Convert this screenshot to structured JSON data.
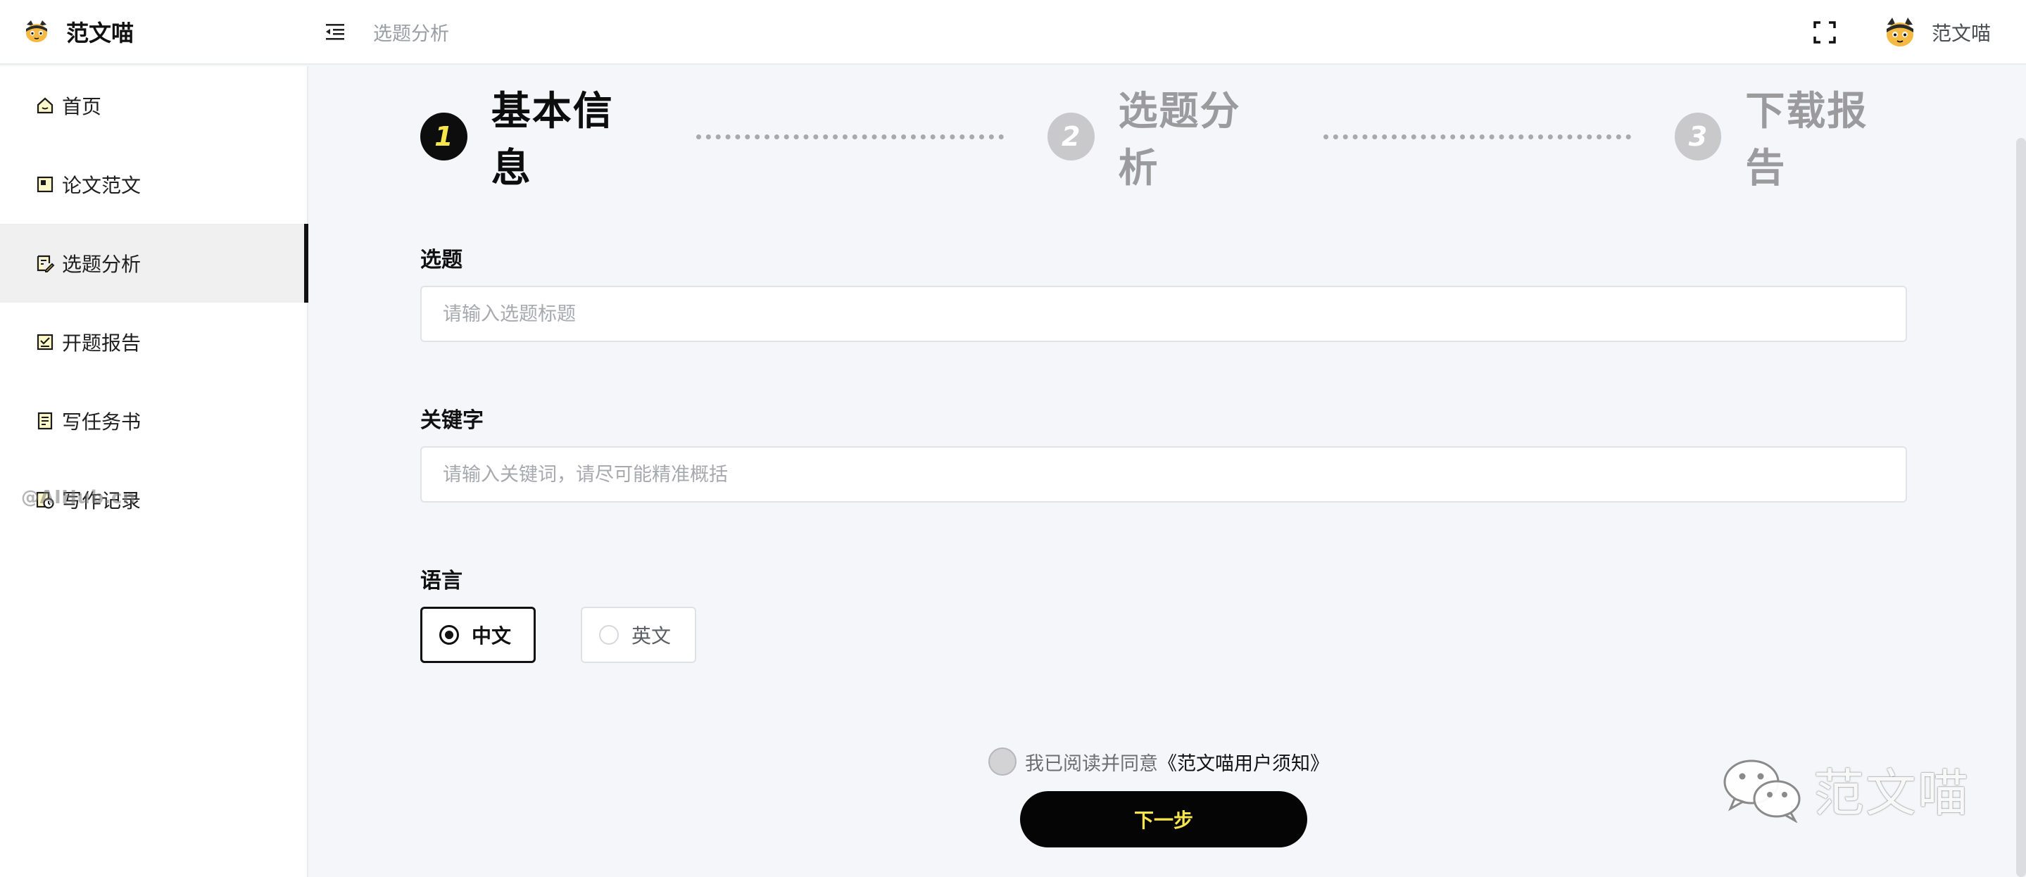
{
  "header": {
    "brand_name": "范文喵",
    "breadcrumb": "选题分析",
    "user_name": "范文喵",
    "menu_icon": "menu-fold-icon",
    "fullscreen_icon": "fullscreen-icon"
  },
  "sidebar": {
    "items": [
      {
        "label": "首页",
        "icon": "home-icon"
      },
      {
        "label": "论文范文",
        "icon": "paper-icon"
      },
      {
        "label": "选题分析",
        "icon": "edit-doc-icon",
        "active": true
      },
      {
        "label": "开题报告",
        "icon": "checklist-icon"
      },
      {
        "label": "写任务书",
        "icon": "notebook-icon"
      },
      {
        "label": "写作记录",
        "icon": "history-icon"
      }
    ],
    "watermark": "@AIHub.cn"
  },
  "steps": [
    {
      "number": "1",
      "label": "基本信息",
      "state": "current"
    },
    {
      "number": "2",
      "label": "选题分析",
      "state": "pending"
    },
    {
      "number": "3",
      "label": "下载报告",
      "state": "pending"
    }
  ],
  "form": {
    "topic": {
      "label": "选题",
      "placeholder": "请输入选题标题",
      "value": ""
    },
    "keywords": {
      "label": "关键字",
      "placeholder": "请输入关键词，请尽可能精准概括",
      "value": ""
    },
    "language": {
      "label": "语言",
      "options": [
        {
          "label": "中文",
          "selected": true
        },
        {
          "label": "英文",
          "selected": false
        }
      ]
    }
  },
  "agreement": {
    "prefix": "我已阅读并同意",
    "link": "《范文喵用户须知》",
    "checked": false
  },
  "next_button": "下一步",
  "watermark_bottom": "范文喵",
  "colors": {
    "accent_yellow": "#f7e64b",
    "primary_black": "#0d0d0d",
    "background": "#f4f6f9",
    "pending_gray": "#9b9b9d"
  }
}
